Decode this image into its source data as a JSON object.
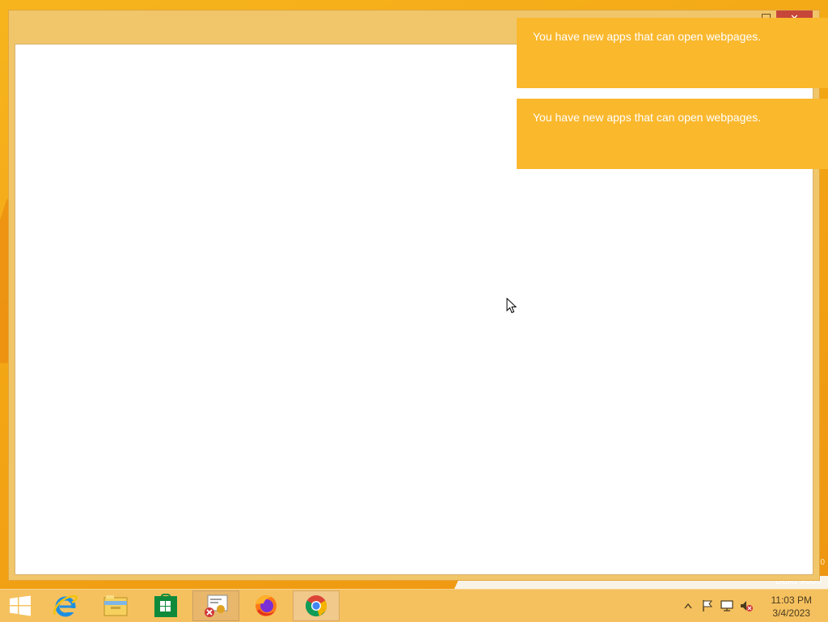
{
  "notifications": [
    {
      "message": "You have new apps that can open webpages."
    },
    {
      "message": "You have new apps that can open webpages."
    }
  ],
  "window": {
    "close_glyph": "✕"
  },
  "taskbar": {
    "items": [
      {
        "name": "start-button",
        "icon": "windows-logo-icon"
      },
      {
        "name": "internet-explorer",
        "icon": "internet-explorer-icon"
      },
      {
        "name": "file-explorer",
        "icon": "folder-icon"
      },
      {
        "name": "store",
        "icon": "store-icon"
      },
      {
        "name": "certificate-app",
        "icon": "certificate-icon"
      },
      {
        "name": "firefox",
        "icon": "firefox-icon"
      },
      {
        "name": "chrome",
        "icon": "chrome-icon"
      }
    ],
    "tray": {
      "icons": [
        "show-hidden-icons-icon",
        "action-center-flag-icon",
        "network-icon",
        "volume-muted-icon"
      ],
      "time": "11:03 PM",
      "date": "3/4/2023"
    }
  },
  "desktop": {
    "watermark": "Build 9600",
    "watermark_edge": "0"
  },
  "colors": {
    "accent": "#fab82d",
    "desktop": "#f3a514",
    "taskbar": "#f5c15f",
    "close": "#c6463a"
  }
}
